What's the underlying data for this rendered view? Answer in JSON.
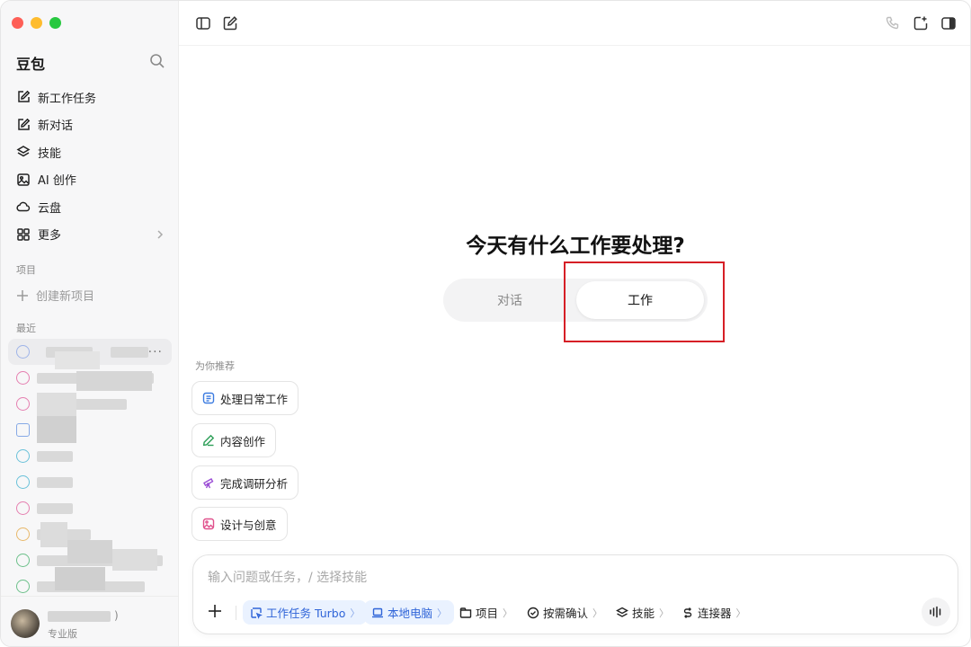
{
  "sidebar": {
    "app_title": "豆包",
    "nav": [
      {
        "label": "新工作任务",
        "icon": "edit-icon"
      },
      {
        "label": "新对话",
        "icon": "edit-icon"
      },
      {
        "label": "技能",
        "icon": "layers-icon"
      },
      {
        "label": "AI 创作",
        "icon": "image-icon"
      },
      {
        "label": "云盘",
        "icon": "cloud-icon"
      },
      {
        "label": "更多",
        "icon": "grid-icon"
      }
    ],
    "projects_label": "项目",
    "new_project": "创建新项目",
    "recent_label": "最近",
    "recent_icon_colors": [
      "#9fb4e8",
      "#e57fb0",
      "#e57fb0",
      "#86a9e6",
      "#6ac1d9",
      "#6ac1d9",
      "#e57fb0",
      "#e8b86a",
      "#6cc08a",
      "#6cc08a"
    ],
    "user_chevron": ")",
    "user_plan": "专业版"
  },
  "main": {
    "headline": "今天有什么工作要处理?",
    "mode_tabs": {
      "left": "对话",
      "right": "工作",
      "selected": "工作"
    },
    "recommend_label": "为你推荐",
    "suggestions": [
      {
        "label": "处理日常工作",
        "icon": "doc-icon",
        "color": "#3b7be0"
      },
      {
        "label": "内容创作",
        "icon": "pen-icon",
        "color": "#2e9f58"
      },
      {
        "label": "完成调研分析",
        "icon": "telescope-icon",
        "color": "#9c4fd6"
      },
      {
        "label": "设计与创意",
        "icon": "picture-icon",
        "color": "#e0508c"
      }
    ]
  },
  "composer": {
    "placeholder": "输入问题或任务，/ 选择技能",
    "tools": [
      {
        "label": "工作任务 Turbo",
        "icon": "task-icon",
        "active": true
      },
      {
        "label": "本地电脑",
        "icon": "laptop-icon",
        "active": true
      },
      {
        "label": "项目",
        "icon": "folder-icon",
        "active": false
      },
      {
        "label": "按需确认",
        "icon": "check-circle-icon",
        "active": false
      },
      {
        "label": "技能",
        "icon": "layers-icon",
        "active": false
      },
      {
        "label": "连接器",
        "icon": "link-icon",
        "active": false
      }
    ],
    "arrow": "〉"
  },
  "colors": {
    "accent_blue": "#2f64d8",
    "highlight_red": "#d61f26"
  }
}
